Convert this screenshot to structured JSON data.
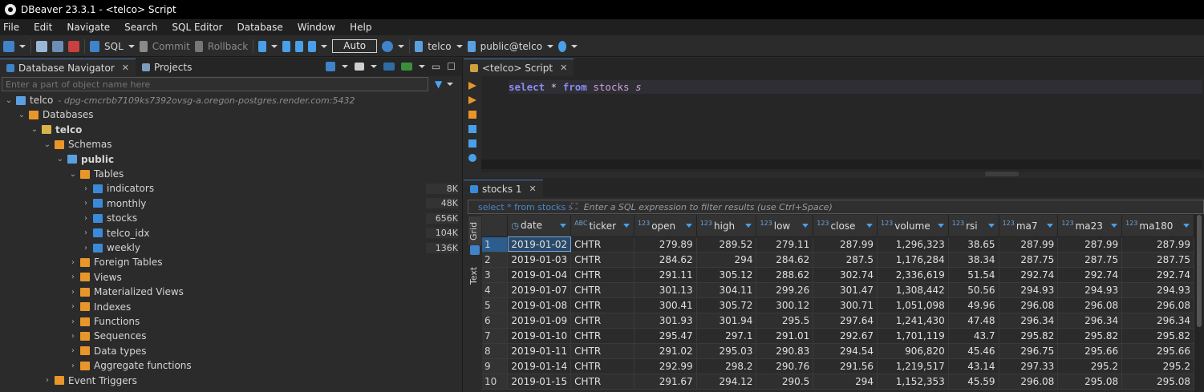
{
  "window": {
    "title": "DBeaver 23.3.1 - <telco> Script"
  },
  "menu": [
    "File",
    "Edit",
    "Navigate",
    "Search",
    "SQL Editor",
    "Database",
    "Window",
    "Help"
  ],
  "toolbar": {
    "sql_label": "SQL",
    "commit_label": "Commit",
    "rollback_label": "Rollback",
    "mode_label": "Auto",
    "connection_label": "telco",
    "schema_label": "public@telco"
  },
  "navigator": {
    "tabs": [
      {
        "label": "Database Navigator",
        "active": true
      },
      {
        "label": "Projects",
        "active": false
      }
    ],
    "filter_placeholder": "Enter a part of object name here",
    "tree": [
      {
        "label": "telco",
        "detail": "- dpg-cmcrbb7109ks7392ovsg-a.oregon-postgres.render.com:5432",
        "icon": "connection-icon",
        "expanded": true,
        "bold": false
      },
      {
        "label": "Databases",
        "icon": "folder-icon",
        "expanded": true
      },
      {
        "label": "telco",
        "icon": "database-icon",
        "expanded": true,
        "bold": true
      },
      {
        "label": "Schemas",
        "icon": "folder-icon",
        "expanded": true
      },
      {
        "label": "public",
        "icon": "schema-icon",
        "expanded": true,
        "bold": true
      },
      {
        "label": "Tables",
        "icon": "folder-icon",
        "expanded": true
      },
      {
        "label": "indicators",
        "icon": "table-icon",
        "size": "8K"
      },
      {
        "label": "monthly",
        "icon": "table-icon",
        "size": "48K"
      },
      {
        "label": "stocks",
        "icon": "table-icon",
        "size": "656K"
      },
      {
        "label": "telco_idx",
        "icon": "table-icon",
        "size": "104K"
      },
      {
        "label": "weekly",
        "icon": "table-icon",
        "size": "136K"
      },
      {
        "label": "Foreign Tables",
        "icon": "folder-icon"
      },
      {
        "label": "Views",
        "icon": "folder-icon"
      },
      {
        "label": "Materialized Views",
        "icon": "folder-icon"
      },
      {
        "label": "Indexes",
        "icon": "folder-icon"
      },
      {
        "label": "Functions",
        "icon": "folder-icon"
      },
      {
        "label": "Sequences",
        "icon": "folder-icon"
      },
      {
        "label": "Data types",
        "icon": "folder-icon"
      },
      {
        "label": "Aggregate functions",
        "icon": "folder-icon"
      },
      {
        "label": "Event Triggers",
        "icon": "folder-icon"
      }
    ]
  },
  "editor": {
    "tab_label": "<telco> Script",
    "sql": {
      "kw1": "select",
      "star": " * ",
      "kw2": "from",
      "table": "stocks",
      "alias": "s"
    }
  },
  "results": {
    "tab_label": "stocks 1",
    "filter_query": "select * from stocks s",
    "filter_hint": "Enter a SQL expression to filter results (use Ctrl+Space)",
    "side_tabs": [
      "Grid",
      "Text"
    ],
    "columns": [
      {
        "name": "date",
        "type": ""
      },
      {
        "name": "ticker",
        "type": "ABC"
      },
      {
        "name": "open",
        "type": "123"
      },
      {
        "name": "high",
        "type": "123"
      },
      {
        "name": "low",
        "type": "123"
      },
      {
        "name": "close",
        "type": "123"
      },
      {
        "name": "volume",
        "type": "123"
      },
      {
        "name": "rsi",
        "type": "123"
      },
      {
        "name": "ma7",
        "type": "123"
      },
      {
        "name": "ma23",
        "type": "123"
      },
      {
        "name": "ma180",
        "type": "123"
      }
    ],
    "rows": [
      [
        "1",
        "2019-01-02",
        "CHTR",
        "279.89",
        "289.52",
        "279.11",
        "287.99",
        "1,296,323",
        "38.65",
        "287.99",
        "287.99",
        "287.99"
      ],
      [
        "2",
        "2019-01-03",
        "CHTR",
        "284.62",
        "294",
        "284.62",
        "287.5",
        "1,176,284",
        "38.34",
        "287.75",
        "287.75",
        "287.75"
      ],
      [
        "3",
        "2019-01-04",
        "CHTR",
        "291.11",
        "305.12",
        "288.62",
        "302.74",
        "2,336,619",
        "51.54",
        "292.74",
        "292.74",
        "292.74"
      ],
      [
        "4",
        "2019-01-07",
        "CHTR",
        "301.13",
        "304.11",
        "299.26",
        "301.47",
        "1,308,442",
        "50.56",
        "294.93",
        "294.93",
        "294.93"
      ],
      [
        "5",
        "2019-01-08",
        "CHTR",
        "300.41",
        "305.72",
        "300.12",
        "300.71",
        "1,051,098",
        "49.96",
        "296.08",
        "296.08",
        "296.08"
      ],
      [
        "6",
        "2019-01-09",
        "CHTR",
        "301.93",
        "301.94",
        "295.5",
        "297.64",
        "1,241,430",
        "47.48",
        "296.34",
        "296.34",
        "296.34"
      ],
      [
        "7",
        "2019-01-10",
        "CHTR",
        "295.47",
        "297.1",
        "291.01",
        "292.67",
        "1,701,119",
        "43.7",
        "295.82",
        "295.82",
        "295.82"
      ],
      [
        "8",
        "2019-01-11",
        "CHTR",
        "291.02",
        "295.03",
        "290.83",
        "294.54",
        "906,820",
        "45.46",
        "296.75",
        "295.66",
        "295.66"
      ],
      [
        "9",
        "2019-01-14",
        "CHTR",
        "292.99",
        "298.2",
        "290.76",
        "291.56",
        "1,219,517",
        "43.14",
        "297.33",
        "295.2",
        "295.2"
      ],
      [
        "10",
        "2019-01-15",
        "CHTR",
        "291.67",
        "294.12",
        "290.5",
        "294",
        "1,152,353",
        "45.59",
        "296.08",
        "295.08",
        "295.08"
      ]
    ]
  }
}
